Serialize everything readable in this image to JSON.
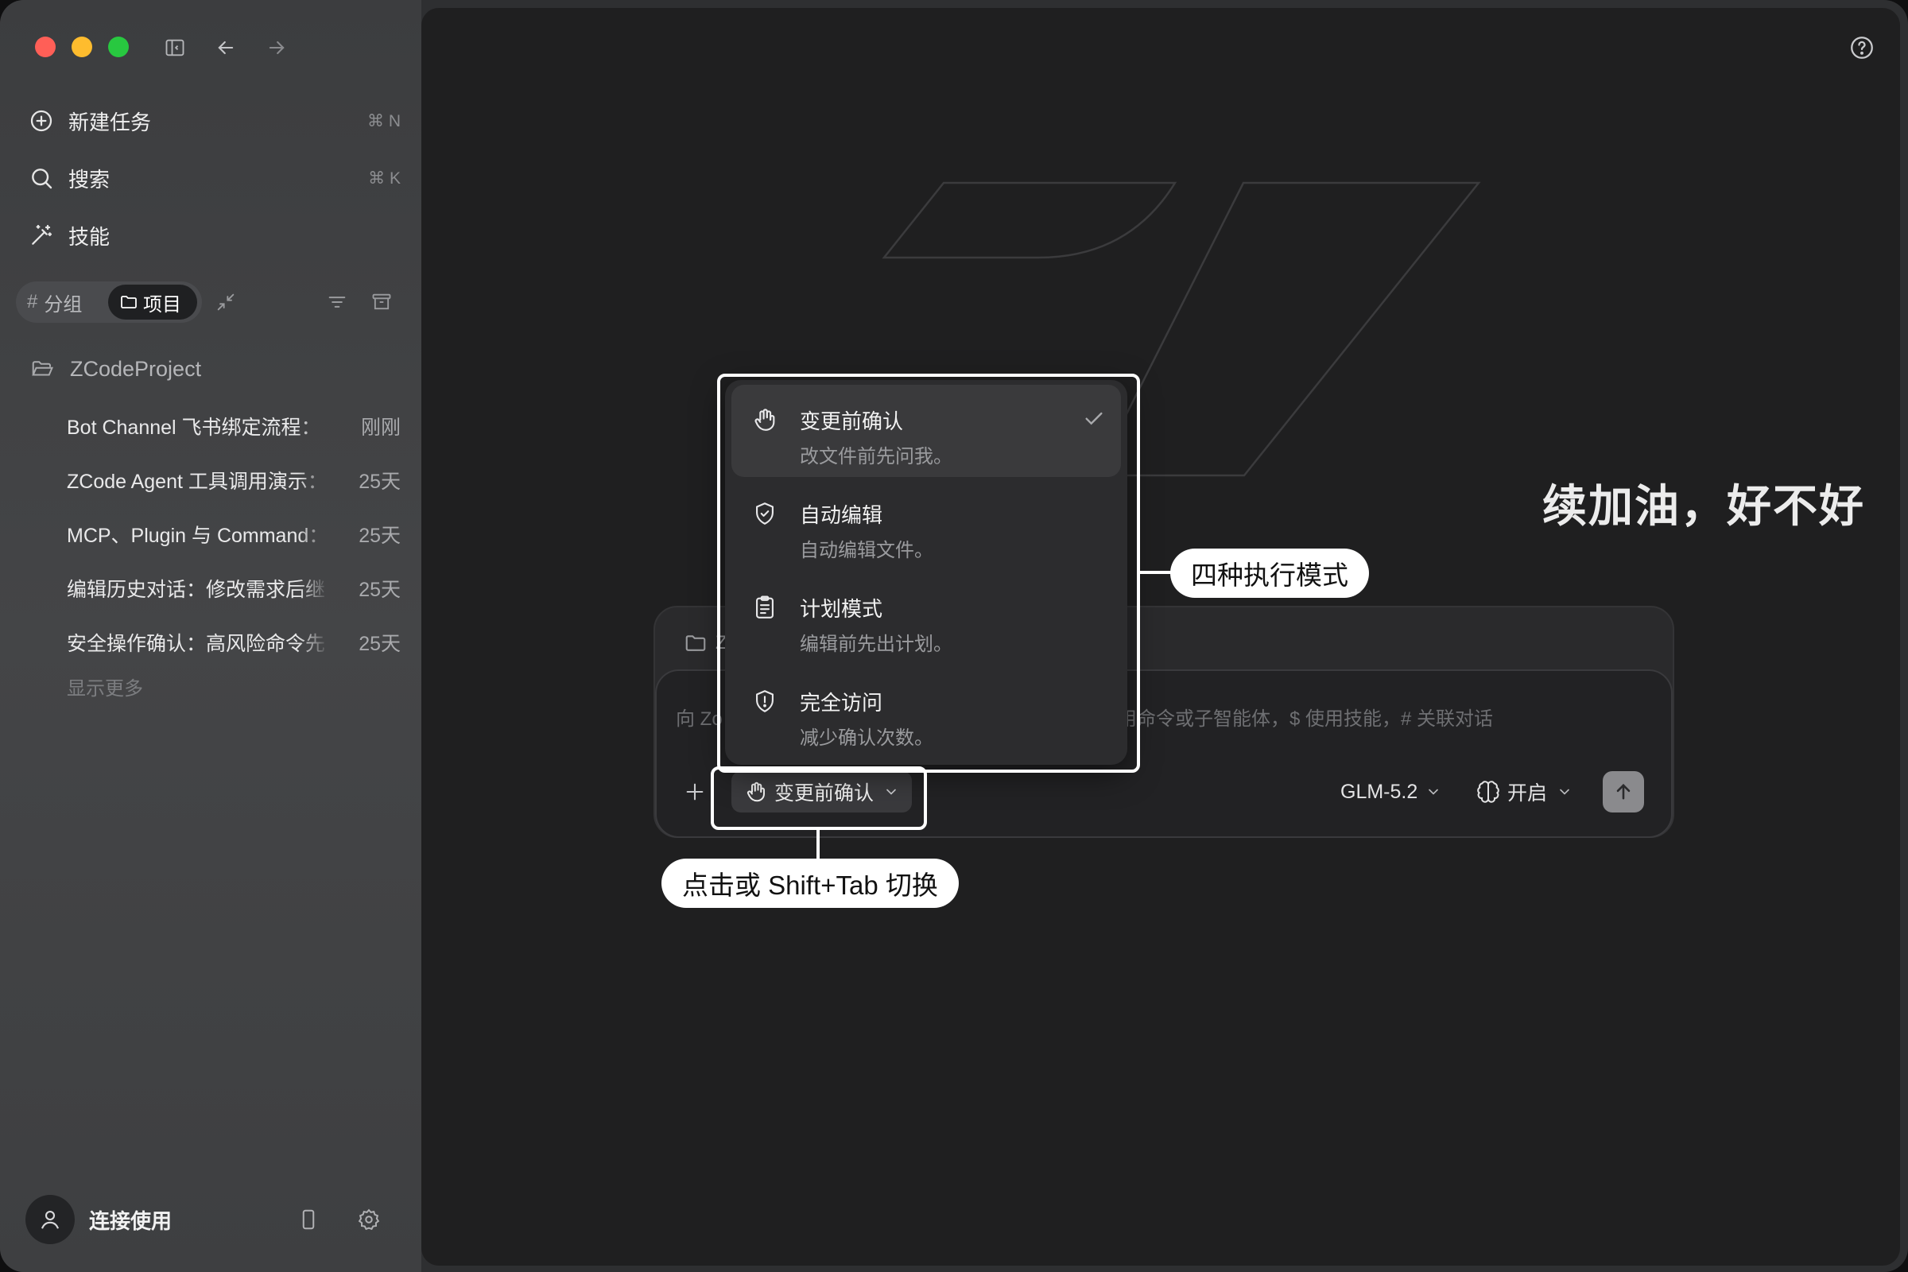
{
  "sidebar": {
    "nav": [
      {
        "label": "新建任务",
        "shortcut": "⌘ N"
      },
      {
        "label": "搜索",
        "shortcut": "⌘ K"
      },
      {
        "label": "技能",
        "shortcut": ""
      }
    ],
    "segments": {
      "group": "分组",
      "project": "项目"
    },
    "project_name": "ZCodeProject",
    "tasks": [
      {
        "title": "Bot Channel 飞书绑定流程：",
        "time": "刚刚"
      },
      {
        "title": "ZCode Agent 工具调用演示：",
        "time": "25天"
      },
      {
        "title": "MCP、Plugin 与 Command：",
        "time": "25天"
      },
      {
        "title": "编辑历史对话：修改需求后继",
        "time": "25天"
      },
      {
        "title": "安全操作确认：高风险命令先",
        "time": "25天"
      }
    ],
    "show_more": "显示更多",
    "user_label": "连接使用"
  },
  "main": {
    "headline": "续加油，好不好",
    "composer": {
      "folder_label": "Z",
      "placeholder_left": "向 Zo",
      "placeholder_right": "用命令或子智能体，$ 使用技能，# 关联对话",
      "mode_label": "变更前确认",
      "model": "GLM-5.2",
      "thinking": "开启"
    }
  },
  "mode_menu": {
    "items": [
      {
        "title": "变更前确认",
        "desc": "改文件前先问我。",
        "icon": "hand-icon",
        "selected": true
      },
      {
        "title": "自动编辑",
        "desc": "自动编辑文件。",
        "icon": "shield-check-icon",
        "selected": false
      },
      {
        "title": "计划模式",
        "desc": "编辑前先出计划。",
        "icon": "clipboard-icon",
        "selected": false
      },
      {
        "title": "完全访问",
        "desc": "减少确认次数。",
        "icon": "shield-alert-icon",
        "selected": false
      }
    ]
  },
  "annotations": {
    "modes_callout": "四种执行模式",
    "switch_callout": "点击或 Shift+Tab 切换"
  },
  "colors": {
    "traffic_red": "#ff5f57",
    "traffic_yellow": "#febc2e",
    "traffic_green": "#28c840"
  }
}
